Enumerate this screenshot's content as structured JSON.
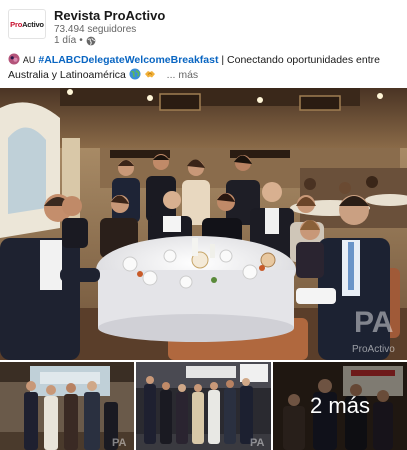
{
  "post": {
    "author": "Revista ProActivo",
    "logo_text_pro": "Pro",
    "logo_text_activo": "Activo",
    "followers": "73.494 seguidores",
    "time": "1 día",
    "bullet": "•",
    "text_prefix": "AU",
    "hashtag": "#ALABCDelegateWelcomeBreakfast",
    "text_body": " | Conectando oportunidades entre Australia y Latinoamérica ",
    "more_label": "... más"
  },
  "media": {
    "watermark_main": "ProActivo",
    "more_photos_label": "2 más"
  }
}
